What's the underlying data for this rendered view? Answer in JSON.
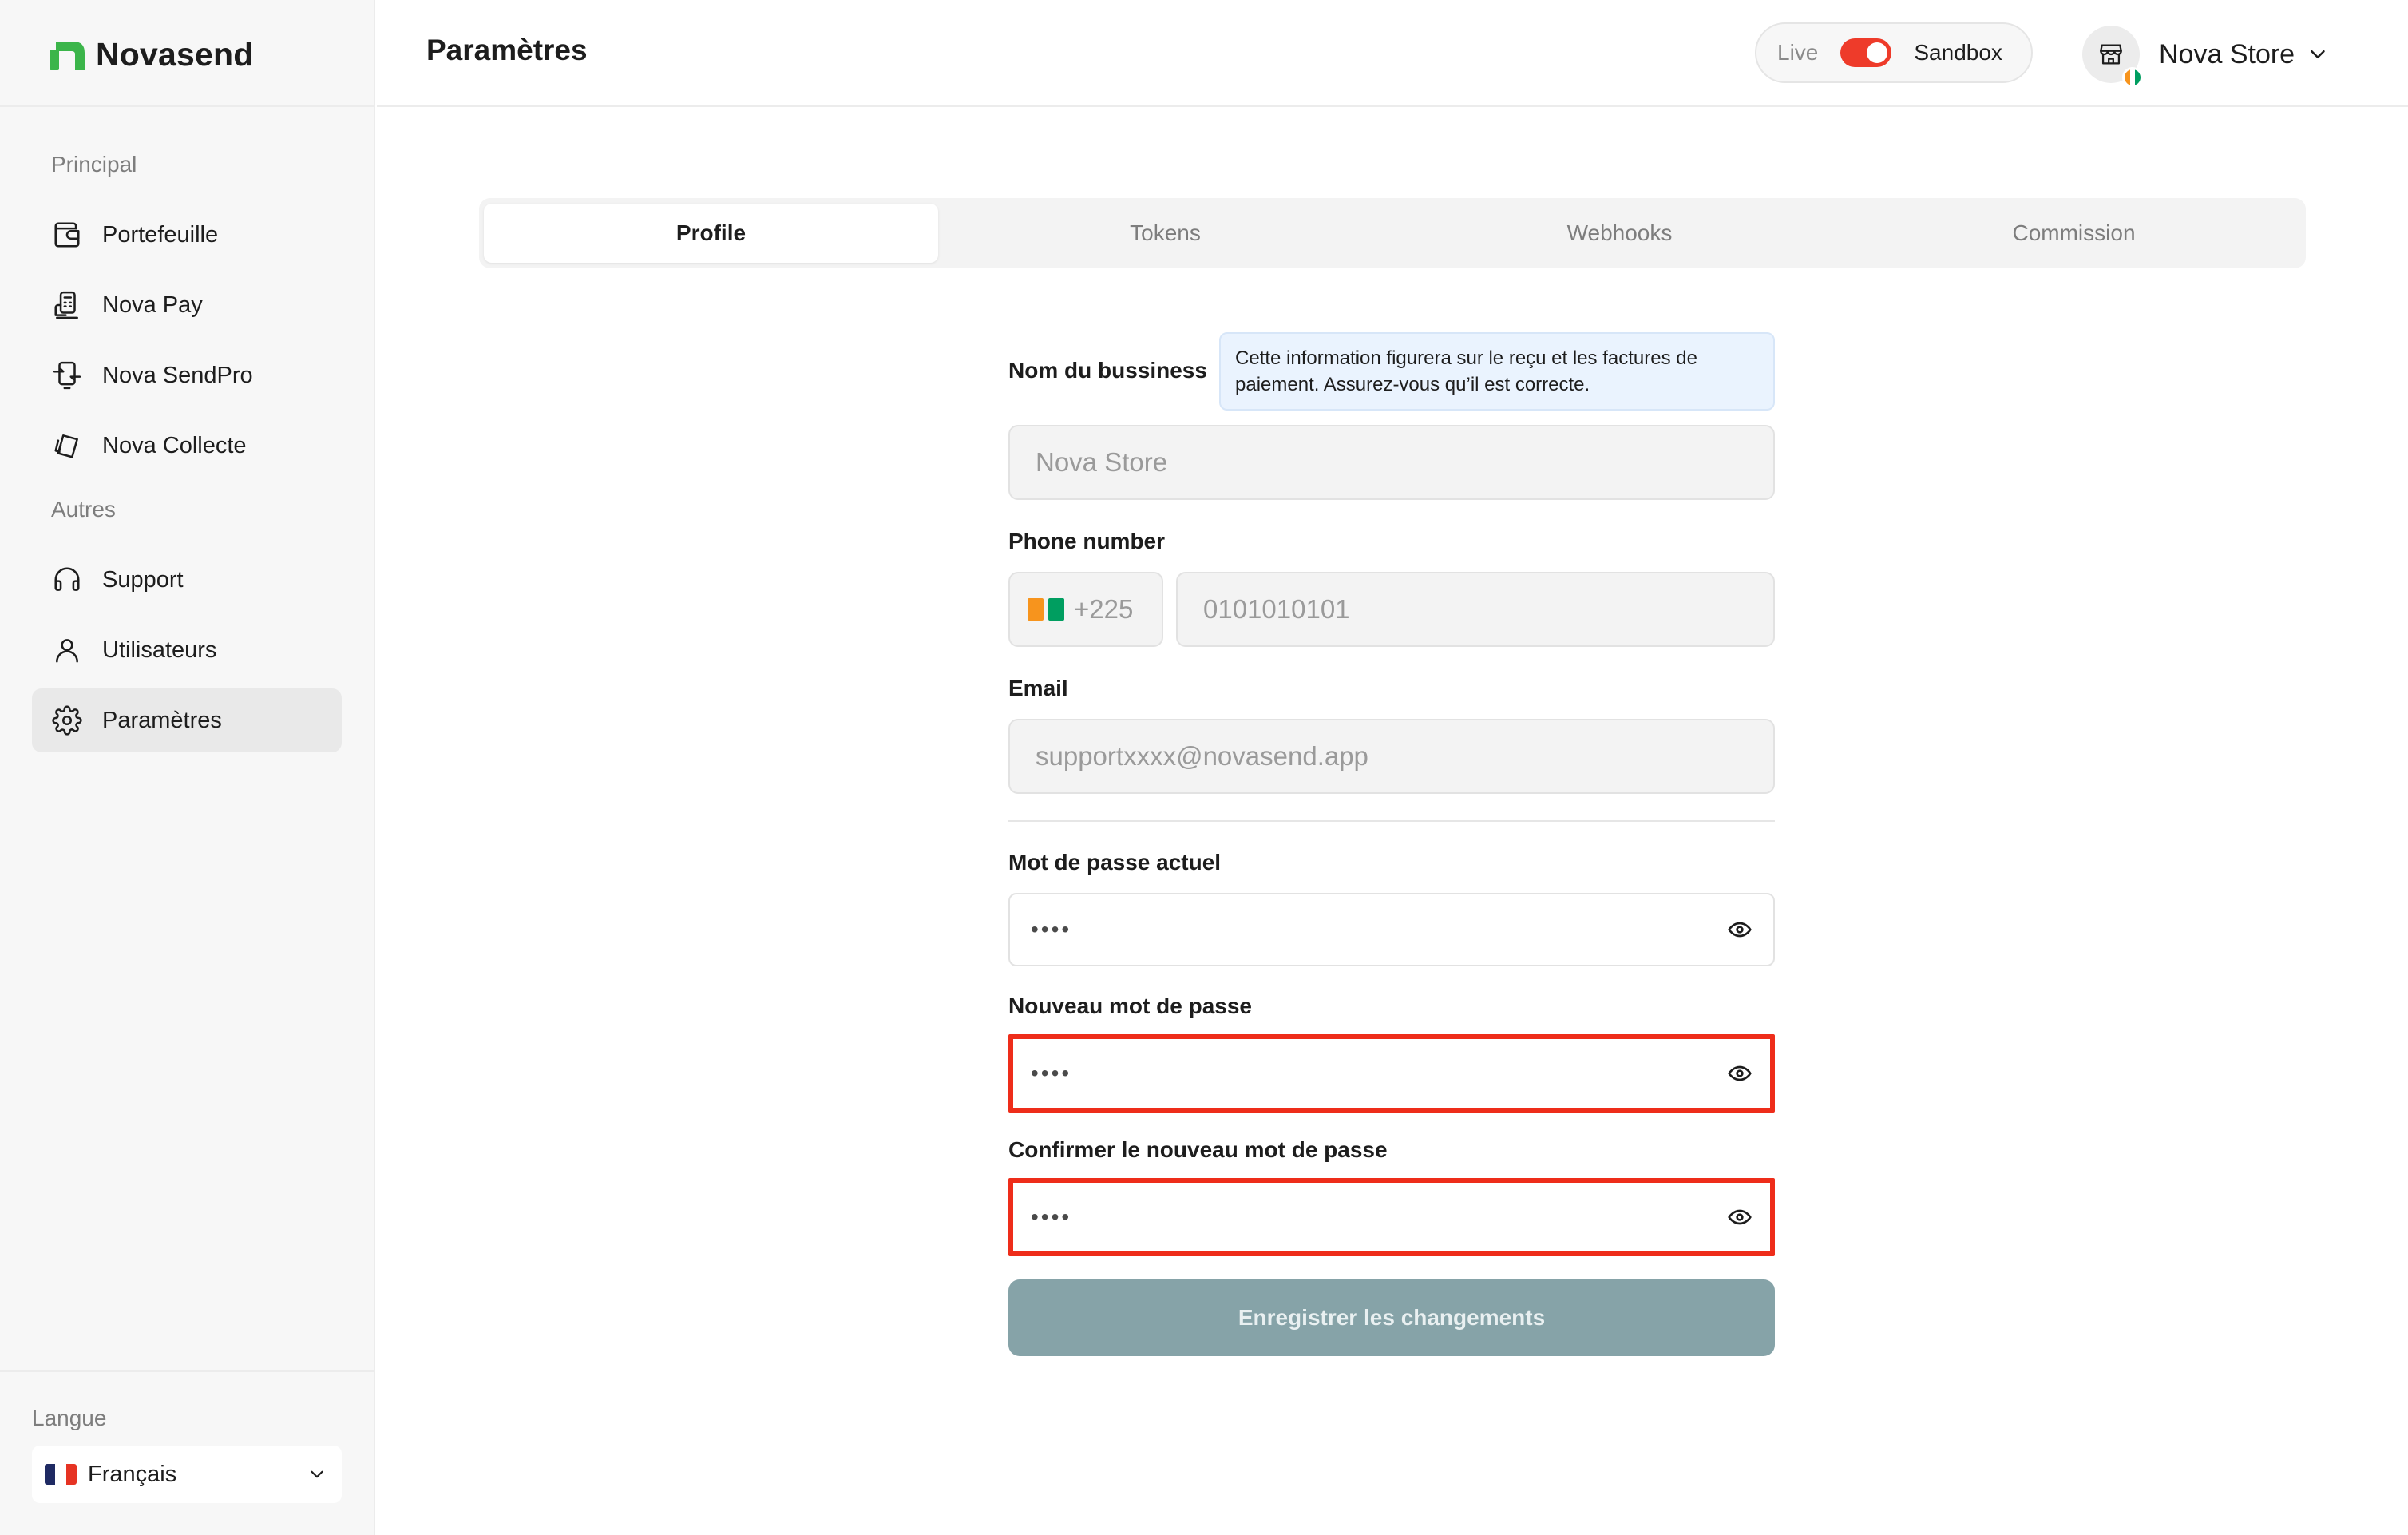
{
  "brand": {
    "name": "Novasend",
    "color": "#3bb54a"
  },
  "sidebar": {
    "sections": [
      "Principal",
      "Autres"
    ],
    "items": [
      {
        "label": "Portefeuille",
        "icon": "wallet-icon"
      },
      {
        "label": "Nova Pay",
        "icon": "pos-terminal-icon"
      },
      {
        "label": "Nova SendPro",
        "icon": "transfer-icon"
      },
      {
        "label": "Nova Collecte",
        "icon": "cards-icon"
      },
      {
        "label": "Support",
        "icon": "headset-icon"
      },
      {
        "label": "Utilisateurs",
        "icon": "user-icon"
      },
      {
        "label": "Paramètres",
        "icon": "gear-icon",
        "active": true
      }
    ],
    "language": {
      "label": "Langue",
      "value": "Français"
    }
  },
  "header": {
    "title": "Paramètres",
    "env": {
      "live": "Live",
      "sandbox": "Sandbox",
      "toggle_color": "#ee3b2a"
    },
    "store": {
      "name": "Nova Store"
    }
  },
  "tabs": [
    {
      "label": "Profile",
      "active": true
    },
    {
      "label": "Tokens"
    },
    {
      "label": "Webhooks"
    },
    {
      "label": "Commission"
    }
  ],
  "form": {
    "business": {
      "label": "Nom du bussiness",
      "info": "Cette information figurera sur le reçu et les factures de paiement. Assurez-vous qu’il est correcte.",
      "value": "Nova Store"
    },
    "phone": {
      "label": "Phone number",
      "code": "+225",
      "placeholder": "0101010101"
    },
    "email": {
      "label": "Email",
      "placeholder": "supportxxxx@novasend.app"
    },
    "current_password": {
      "label": "Mot de passe actuel",
      "value": "••••"
    },
    "new_password": {
      "label": "Nouveau mot de passe",
      "value": "••••"
    },
    "confirm_password": {
      "label": "Confirmer le nouveau mot de passe",
      "value": "••••"
    },
    "save_label": "Enregistrer les changements",
    "highlight_color": "#ee2d1a"
  }
}
